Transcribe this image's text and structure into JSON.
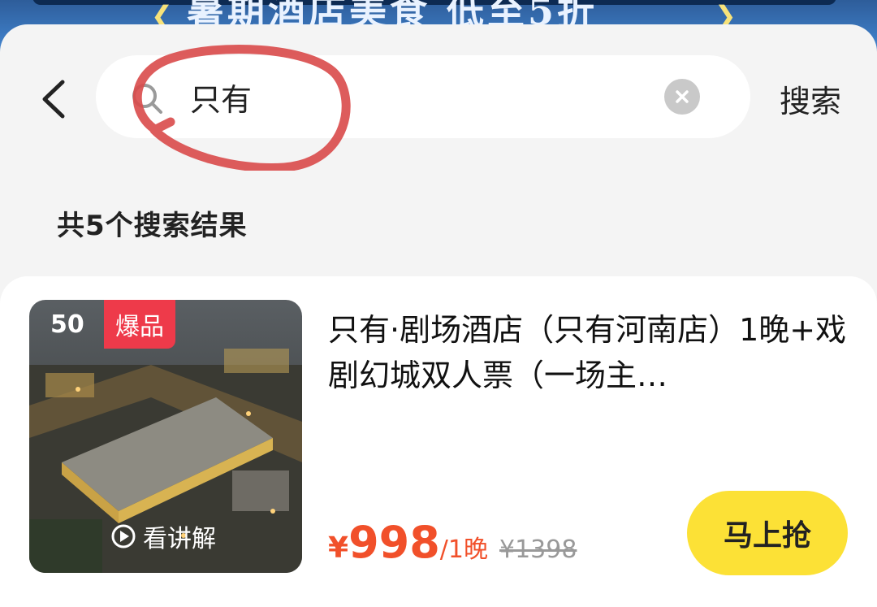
{
  "banner": {
    "text": "暑期酒店美食 低至5折",
    "deco_left": "❮",
    "deco_right": "❯"
  },
  "header": {
    "back_icon": "chevron-left-icon",
    "search": {
      "value": "只有",
      "icon": "search-icon",
      "clear_icon": "clear-icon"
    },
    "search_button_label": "搜索"
  },
  "results": {
    "count_text": "共5个搜索结果"
  },
  "product": {
    "thumb_count": "50",
    "badge": "爆品",
    "explain_label": "看讲解",
    "title": "只有·剧场酒店（只有河南店）1晚+戏剧幻城双人票（一场主…",
    "price_symbol": "¥",
    "price": "998",
    "price_unit": "/1晚",
    "original_price": "¥1398",
    "buy_label": "马上抢"
  },
  "colors": {
    "accent": "#f1502a",
    "badge": "#ee3a4a",
    "buy_button": "#fce136",
    "annotation": "#d94a4a"
  }
}
